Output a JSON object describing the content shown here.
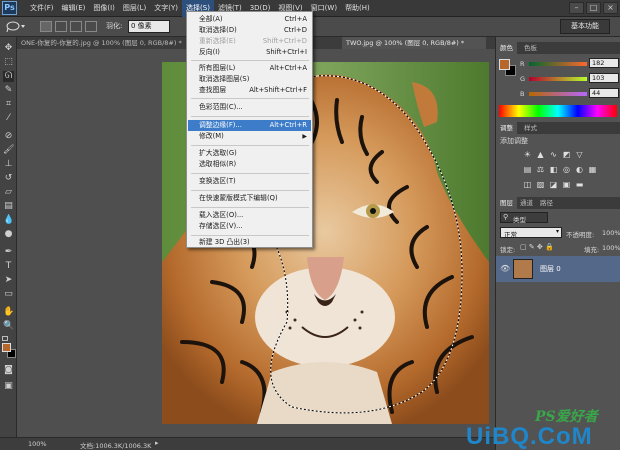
{
  "app": {
    "logo": "Ps"
  },
  "menubar": {
    "items": [
      "文件(F)",
      "编辑(E)",
      "图像(I)",
      "图层(L)",
      "文字(Y)",
      "选择(S)",
      "滤镜(T)",
      "3D(D)",
      "视图(V)",
      "窗口(W)",
      "帮助(H)"
    ],
    "active_index": 5
  },
  "window_controls": [
    "–",
    "□",
    "×"
  ],
  "options": {
    "feather_label": "羽化:",
    "feather_value": "0 像素",
    "workspace": "基本功能"
  },
  "tabs": [
    {
      "label": "ONE-你复的-你复的.jpg @ 100% (图层 0, RGB/8#) *"
    },
    {
      "label": "TWO.jpg @ 100% (图层 0, RGB/8#) *"
    }
  ],
  "status": {
    "zoom": "100%",
    "doc": "文档:1006.3K/1006.3K"
  },
  "select_menu": {
    "items": [
      {
        "label": "全部(A)",
        "shortcut": "Ctrl+A",
        "enabled": true
      },
      {
        "label": "取消选择(D)",
        "shortcut": "Ctrl+D",
        "enabled": true
      },
      {
        "label": "重新选择(E)",
        "shortcut": "Shift+Ctrl+D",
        "enabled": false
      },
      {
        "label": "反向(I)",
        "shortcut": "Shift+Ctrl+I",
        "enabled": true
      },
      {
        "label": "所有图层(L)",
        "shortcut": "Alt+Ctrl+A",
        "enabled": true
      },
      {
        "label": "取消选择图层(S)",
        "shortcut": "",
        "enabled": true
      },
      {
        "label": "查找图层",
        "shortcut": "Alt+Shift+Ctrl+F",
        "enabled": true
      },
      {
        "label": "色彩范围(C)...",
        "shortcut": "",
        "enabled": true
      },
      {
        "label": "调整边缘(F)...",
        "shortcut": "Alt+Ctrl+R",
        "enabled": true,
        "highlighted": true
      },
      {
        "label": "修改(M)",
        "shortcut": "",
        "enabled": true,
        "submenu": true
      },
      {
        "label": "扩大选取(G)",
        "shortcut": "",
        "enabled": true
      },
      {
        "label": "选取相似(R)",
        "shortcut": "",
        "enabled": true
      },
      {
        "label": "变换选区(T)",
        "shortcut": "",
        "enabled": true
      },
      {
        "label": "在快速蒙版模式下编辑(Q)",
        "shortcut": "",
        "enabled": true
      },
      {
        "label": "载入选区(O)...",
        "shortcut": "",
        "enabled": true
      },
      {
        "label": "存储选区(V)...",
        "shortcut": "",
        "enabled": true
      },
      {
        "label": "新建 3D 凸出(3)",
        "shortcut": "",
        "enabled": true
      }
    ]
  },
  "color_panel": {
    "tabs": [
      "颜色",
      "色板"
    ],
    "channels": [
      {
        "label": "R",
        "value": "182"
      },
      {
        "label": "G",
        "value": "103"
      },
      {
        "label": "B",
        "value": "44"
      }
    ],
    "foreground": "#b6672c",
    "background": "#000000"
  },
  "adjust_panel": {
    "tabs": [
      "调整",
      "样式"
    ],
    "title": "添加调整"
  },
  "layers_panel": {
    "tabs": [
      "图层",
      "通道",
      "路径"
    ],
    "filter": "类型",
    "blend_mode": "正常",
    "opacity_label": "不透明度:",
    "opacity": "100%",
    "lock_label": "锁定:",
    "fill_label": "填充:",
    "fill": "100%",
    "layer_name": "图层 0"
  },
  "watermark": {
    "ps": "PS爱好者",
    "site": "UiBQ.CoM"
  }
}
